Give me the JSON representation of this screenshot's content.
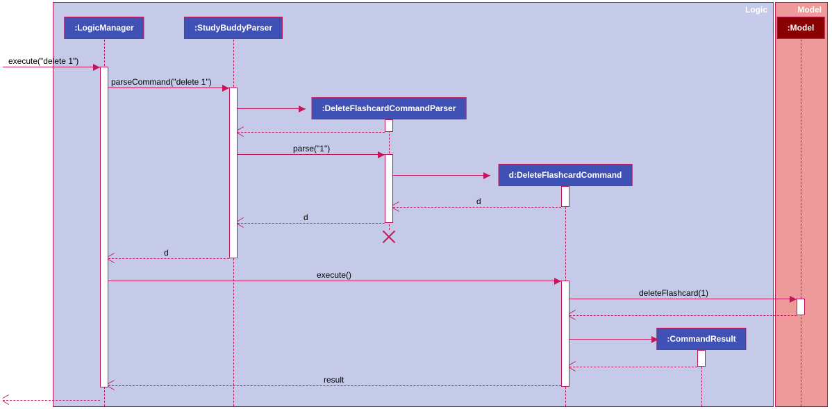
{
  "packages": {
    "logic": "Logic",
    "model": "Model"
  },
  "lifelines": {
    "logicManager": ":LogicManager",
    "parser": ":StudyBuddyParser",
    "deleteParser": ":DeleteFlashcardCommandParser",
    "deleteCmd": "d:DeleteFlashcardCommand",
    "cmdResult": ":CommandResult",
    "model": ":Model"
  },
  "messages": {
    "m1": "execute(\"delete 1\")",
    "m2": "parseCommand(\"delete 1\")",
    "m3": "parse(\"1\")",
    "m4": "d",
    "m5": "d",
    "m6": "d",
    "m7": "execute()",
    "m8": "deleteFlashcard(1)",
    "m9": "result"
  }
}
